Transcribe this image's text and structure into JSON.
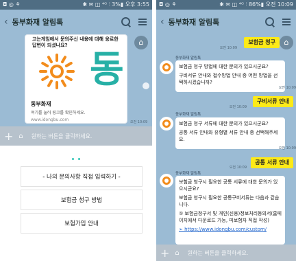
{
  "left": {
    "status": {
      "left_icons": "◘ ◎ ⚘",
      "right_text": "✱ ✉ ◫ ⁴ᴳ ⫶ 3%▮ 오후 3:55"
    },
    "title": "동부화재 알림톡",
    "card": {
      "top_text": "고는게임에서 문의주신 내용에 대해 응료한 답변이 되셨나요?",
      "logo_letter": "동",
      "name": "동부화재",
      "desc": "여기를 눌러 링크를 확인하세요.",
      "url": "www.idongbu.com",
      "time": "오전 10:09"
    },
    "input_placeholder": "원하는 버튼을 클릭하세요.",
    "menu_buttons": [
      "- 나의 문의사항 직접 입력하기 -",
      "보험금 청구 방법",
      "보험가입 안내"
    ]
  },
  "right": {
    "status": {
      "left_icons": "◘ ◎ ⚘",
      "right_text": "✱ ✉ ◫ ⁴ᴳ ⫶ 86%▮ 오전 10:09"
    },
    "title": "동부화재 알림톡",
    "messages": [
      {
        "type": "user",
        "text": "보험금 청구",
        "time": "오전 10:09"
      },
      {
        "type": "bot",
        "name": "동부화재 알림톡",
        "lines": [
          "보험금 청구 방법에 대한 문의가 있으시군요?",
          "구비서류 안내와 접수방법 안내 중 어떤 방법을 선택하시겠습니까?"
        ],
        "time": "오전 10:09"
      },
      {
        "type": "user",
        "text": "구비서류 안내",
        "time": "오전 10:09"
      },
      {
        "type": "bot",
        "name": "동부화재 알림톡",
        "lines": [
          "보험금 청구 서류에 대한 문의가 있으시군요?",
          "공통 서류 안내와 유형별 서류 안내 중 선택해주세요."
        ],
        "time": "오전 10:09"
      },
      {
        "type": "user",
        "text": "공통 서류 안내",
        "time": "오전 10:09"
      },
      {
        "type": "bot",
        "name": "동부화재 알림톡",
        "lines": [
          "보험금 청구시 필요한 공통 서류에 대한 문의가 있으시군요?",
          "보험금 청구시 필요한 공통구비서류는 다음과 같습니다.",
          "① 보험금청구서 및 개인(신용)정보처리동의서(홈페이지에서 다운로드 가능, 피보험자 직접 작성)",
          "➢ https://www.idongbu.com/custom/"
        ]
      }
    ],
    "input_placeholder": "원하는 버튼을 클릭하세요."
  },
  "colors": {
    "chat_bg": "#9bbbd4",
    "user_bubble": "#fdea18",
    "logo_teal": "#27b0a6",
    "logo_orange": "#f28c1c"
  }
}
